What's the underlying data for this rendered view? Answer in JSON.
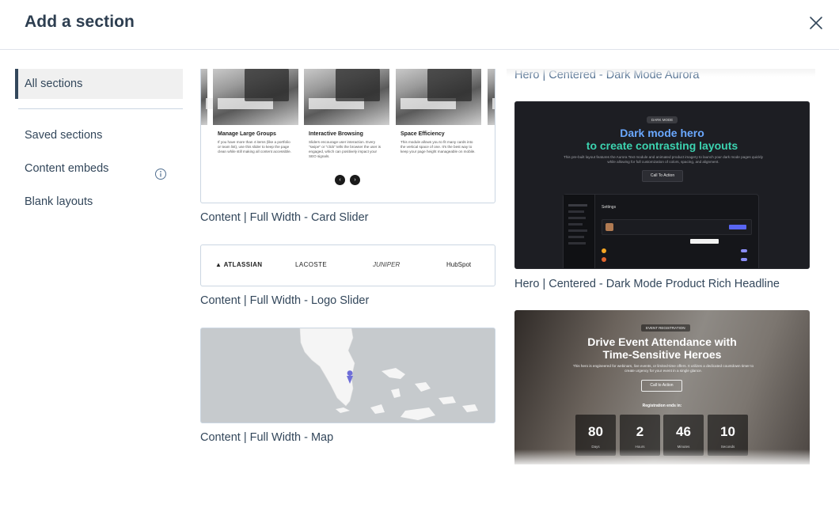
{
  "modal": {
    "title": "Add a section",
    "close_icon": "close-icon"
  },
  "sidebar": {
    "items": [
      {
        "label": "All sections",
        "active": true
      },
      {
        "label": "Saved sections"
      },
      {
        "label": "Content embeds",
        "icon": "info-icon"
      },
      {
        "label": "Blank layouts"
      }
    ]
  },
  "colors": {
    "accent_text": "#33475b",
    "dark_hero_bg": "#1d1e23",
    "dark_hero_gradient": [
      "#4fa8ff",
      "#31d6a6"
    ]
  },
  "sections": {
    "card_slider": {
      "label": "Content | Full Width - Card Slider",
      "tiles": [
        {
          "title": "Manage Large Groups",
          "text": "If you have more than 4 items (like a portfolio or team list), use this slider to keep the page clean while still making all content accessible."
        },
        {
          "title": "Interactive Browsing",
          "text": "Sliders encourage user interaction. Every \"swipe\" or \"click\" tells the browser the user is engaged, which can positively impact your SEO signals."
        },
        {
          "title": "Space Efficiency",
          "text": "This module allows you to fit many cards into the vertical space of one. It's the best way to keep your page height manageable on mobile."
        }
      ],
      "prev_icon": "chevron-left-icon",
      "next_icon": "chevron-right-icon"
    },
    "logo_slider": {
      "label": "Content | Full Width - Logo Slider",
      "logos": [
        "ATLASSIAN",
        "LACOSTE",
        "JUNIPER",
        "HubSpot"
      ]
    },
    "map": {
      "label": "Content | Full Width - Map"
    },
    "dark_aurora": {
      "label": "Hero | Centered - Dark Mode Aurora"
    },
    "dark_product": {
      "label": "Hero | Centered - Dark Mode Product Rich Headline",
      "badge": "DARK MODE",
      "headline_1": "Dark mode hero",
      "headline_2": "to create contrasting layouts",
      "body": "This pre-built layout features the Aurora Text module and animated product imagery to launch your dark mode pages quickly while allowing for full customization of colors, spacing, and alignment.",
      "cta": "Call To Action",
      "app_title": "Settings"
    },
    "event": {
      "badge": "EVENT REGISTRATION",
      "headline_1": "Drive Event Attendance with",
      "headline_2": "Time-Sensitive Heroes",
      "body": "This hero is engineered for webinars, live events, or limited-time offers. It utilizes a dedicated countdown timer to create urgency for your event in a single glance.",
      "cta": "Call to Action",
      "reg_text": "Registration ends in:",
      "countdown": [
        {
          "value": "80",
          "unit": "Days"
        },
        {
          "value": "2",
          "unit": "Hours"
        },
        {
          "value": "46",
          "unit": "Minutes"
        },
        {
          "value": "10",
          "unit": "Seconds"
        }
      ]
    }
  }
}
